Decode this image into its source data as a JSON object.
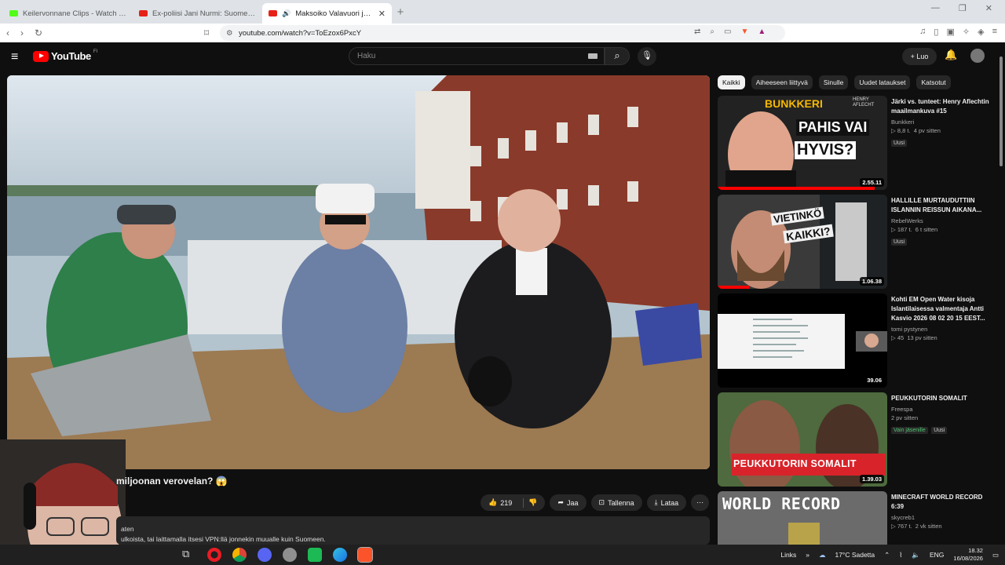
{
  "browser": {
    "tabs": [
      {
        "title": "Keilervonnane Clips - Watch Live on Kick"
      },
      {
        "title": "Ex-poliisi Jani Nurmi: Suomen poliisi"
      },
      {
        "title": "Maksoiko Valavuori just miljoonan verovelan?",
        "active": true
      }
    ],
    "url": "youtube.com/watch?v=ToEzox6PxcY"
  },
  "youtube": {
    "logo_text": "YouTube",
    "country_code": "FI",
    "search_placeholder": "Haku",
    "create_label": "Luo"
  },
  "video": {
    "title": "miljoonan verovelan? 😱",
    "likes": "219",
    "share_label": "Jaa",
    "save_label": "Tallenna",
    "download_label": "Lataa",
    "desc_line1": "aten",
    "desc_line2": "ulkoista, tai laittamalla itsesi VPN:llä jonnekin muualle kuin Suomeen."
  },
  "chips": [
    "Kaikki",
    "Aiheeseen liittyvä",
    "Sinulle",
    "Uudet lataukset",
    "Katsotut"
  ],
  "recommended": [
    {
      "title": "Järki vs. tunteet: Henry Aflechtin maailmankuva #15",
      "channel": "Bunkkeri",
      "views": "8,8 t.",
      "age": "4 pv sitten",
      "badge": "Uusi",
      "duration": "2.55.11",
      "thumb_text1": "BUNKKERI",
      "thumb_text2": "PAHIS VAI",
      "thumb_text3": "HYVIS?",
      "thumb_corner": "HENRY AFLECHT"
    },
    {
      "title": "HALLILLE MURTAUDUTTIIN ISLANNIN REISSUN AIKANA...",
      "channel": "RebelWerks",
      "views": "187 t.",
      "age": "6 t sitten",
      "badge": "Uusi",
      "duration": "1.06.38",
      "thumb_text1": "VIETINKÖ",
      "thumb_text2": "KAIKKI?"
    },
    {
      "title": "Kohti EM Open Water kisoja Islantilaisessa valmentaja Antti Kasvio 2026 08 02 20 15 EEST...",
      "channel": "tomi pystynen",
      "views": "45",
      "age": "13 pv sitten",
      "duration": "39.06"
    },
    {
      "title": "PEUKKUTORIN SOMALIT",
      "channel": "Freespa",
      "age": "2 pv sitten",
      "badge_green": "Vain jäsenille",
      "badge": "Uusi",
      "duration": "1.39.03",
      "thumb_text1": "PEUKKUTORIN SOMALIT"
    },
    {
      "title": "MINECRAFT WORLD RECORD 6:39",
      "channel": "skycreb1",
      "views": "767 t.",
      "age": "2 vk sitten",
      "thumb_text1": "WORLD RECORD"
    }
  ],
  "taskbar": {
    "links_label": "Links",
    "weather": "17°C  Sadetta",
    "lang": "ENG",
    "time": "18.32",
    "date": "16/08/2026"
  },
  "colors": {
    "yt_red": "#ff0000",
    "bg": "#0f0f0f",
    "pill": "#272727"
  }
}
